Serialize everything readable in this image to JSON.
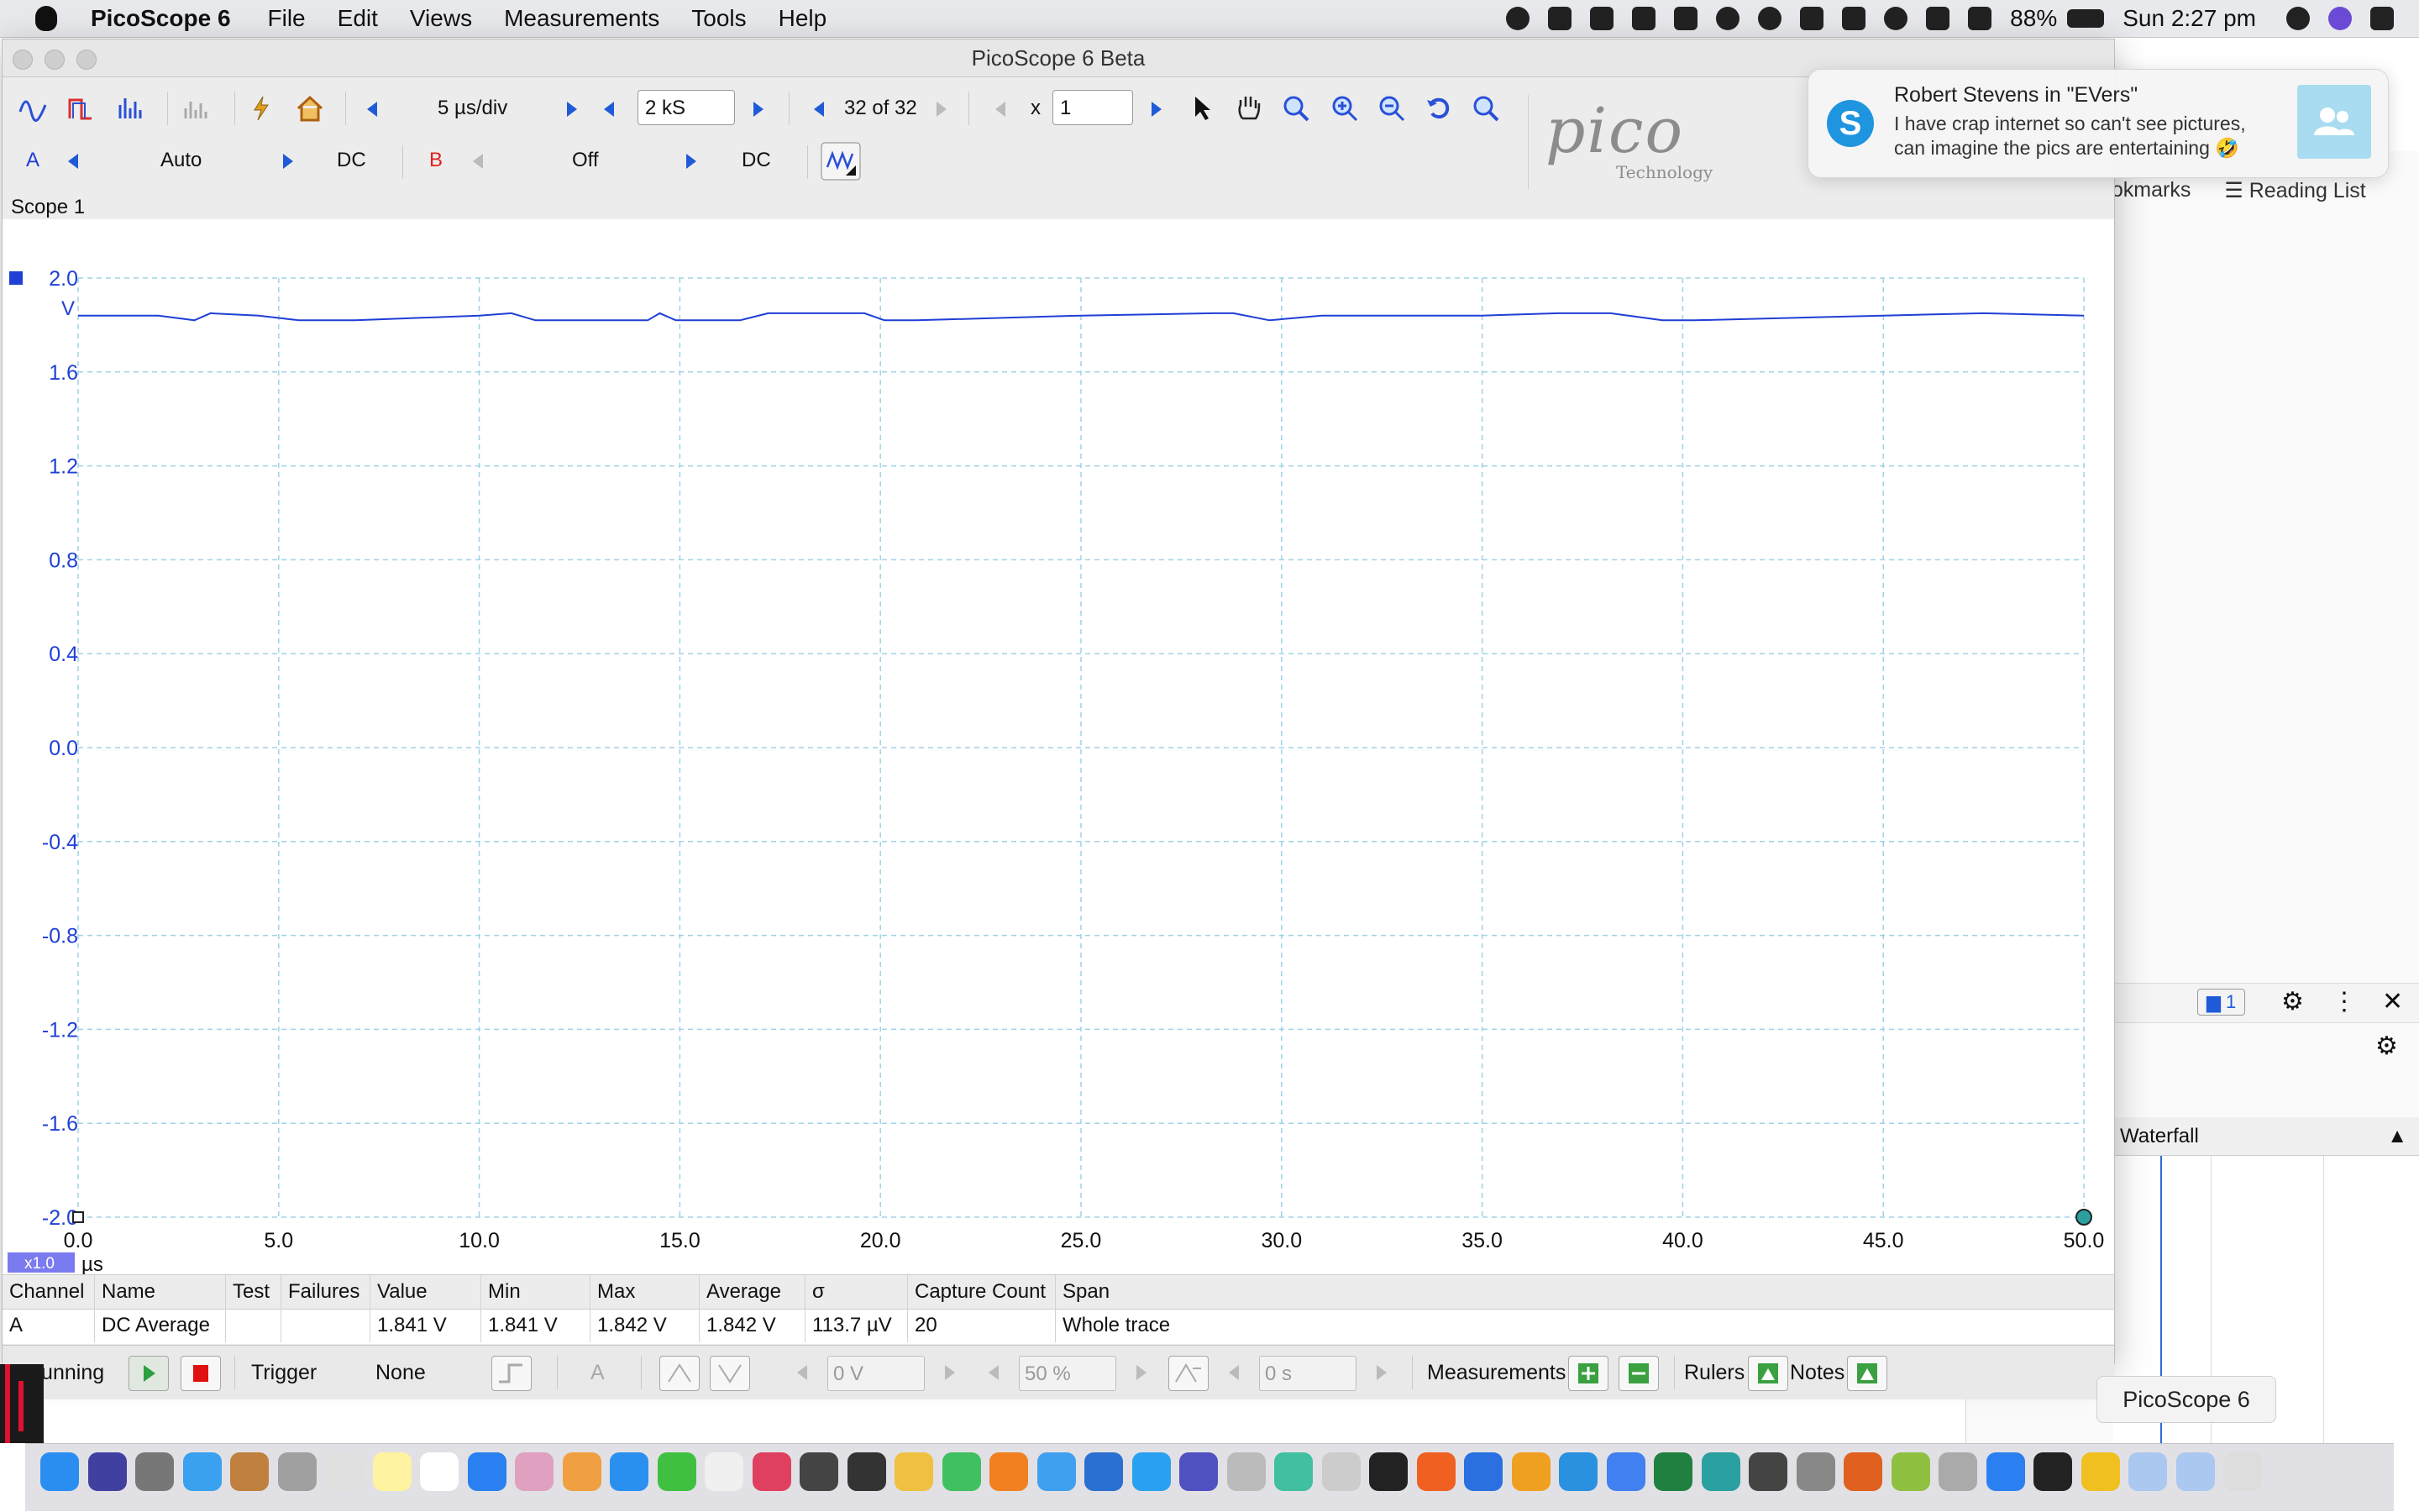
{
  "menubar": {
    "app_name": "PicoScope 6",
    "items": [
      "File",
      "Edit",
      "Views",
      "Measurements",
      "Tools",
      "Help"
    ],
    "battery": "88%",
    "clock": "Sun 2:27 pm"
  },
  "window": {
    "title": "PicoScope 6 Beta"
  },
  "toolbar": {
    "timebase": "5 µs/div",
    "samples": "2 kS",
    "buffer": "32 of 32",
    "zoom_label": "x",
    "zoom_value": "1"
  },
  "channels": {
    "a_label": "A",
    "a_range": "Auto",
    "a_coupling": "DC",
    "b_label": "B",
    "b_range": "Off",
    "b_coupling": "DC"
  },
  "logo": {
    "brand": "pico",
    "sub": "Technology"
  },
  "scope": {
    "label": "Scope 1",
    "y_unit": "V",
    "x_unit": "µs",
    "x_zoom_badge": "x1.0"
  },
  "chart_data": {
    "type": "line",
    "series": [
      {
        "x": [
          0.0,
          2.0,
          2.9,
          3.3,
          4.5,
          5.5,
          6.9,
          10.0,
          10.8,
          11.4,
          12.3,
          14.2,
          14.5,
          14.9,
          16.5,
          17.2,
          19.6,
          20.1,
          20.6,
          20.9,
          25.0,
          28.3,
          28.8,
          29.7,
          31.0,
          35.0,
          36.9,
          38.2,
          39.5,
          40.3,
          45.0,
          47.5,
          50.0
        ],
        "y": [
          1.84,
          1.84,
          1.82,
          1.85,
          1.84,
          1.82,
          1.82,
          1.84,
          1.85,
          1.82,
          1.82,
          1.82,
          1.85,
          1.82,
          1.82,
          1.85,
          1.85,
          1.82,
          1.82,
          1.82,
          1.84,
          1.85,
          1.85,
          1.82,
          1.84,
          1.84,
          1.85,
          1.85,
          1.82,
          1.82,
          1.84,
          1.85,
          1.84
        ],
        "color": "#1f3fd6"
      }
    ],
    "xlim": [
      0.0,
      50.0
    ],
    "ylim": [
      -2.0,
      2.0
    ],
    "x_ticks": [
      "0.0",
      "5.0",
      "10.0",
      "15.0",
      "20.0",
      "25.0",
      "30.0",
      "35.0",
      "40.0",
      "45.0",
      "50.0"
    ],
    "y_ticks": [
      "2.0",
      "1.6",
      "1.2",
      "0.8",
      "0.4",
      "0.0",
      "-0.4",
      "-0.8",
      "-1.2",
      "-1.6",
      "-2.0"
    ],
    "grid": true
  },
  "measurements": {
    "headers": [
      "Channel",
      "Name",
      "Test",
      "Failures",
      "Value",
      "Min",
      "Max",
      "Average",
      "σ",
      "Capture Count",
      "Span"
    ],
    "rows": [
      [
        "A",
        "DC Average",
        "",
        "",
        "1.841 V",
        "1.841 V",
        "1.842 V",
        "1.842 V",
        "113.7 µV",
        "20",
        "Whole trace"
      ]
    ]
  },
  "bottombar": {
    "status": "Running",
    "trigger_label": "Trigger",
    "trigger_mode": "None",
    "trigger_channel": "A",
    "threshold": "0 V",
    "pre_trigger": "50 %",
    "delay": "0 s",
    "measurements_label": "Measurements",
    "rulers_label": "Rulers",
    "notes_label": "Notes"
  },
  "notification": {
    "title": "Robert Stevens in \"EVers\"",
    "body": "I have crap internet so can't see pictures, can imagine the pics are entertaining 🤣"
  },
  "background_window": {
    "bookmarks": "ookmarks",
    "reading_list": "Reading List",
    "badge_count": "1",
    "waterfall": "Waterfall"
  },
  "dock": {
    "tooltip": "PicoScope 6"
  },
  "colors": {
    "trace": "#1f3fd6",
    "grid": "#9fd2e6",
    "axis_text": "#1f3fd6",
    "channel_b": "#e02020"
  }
}
